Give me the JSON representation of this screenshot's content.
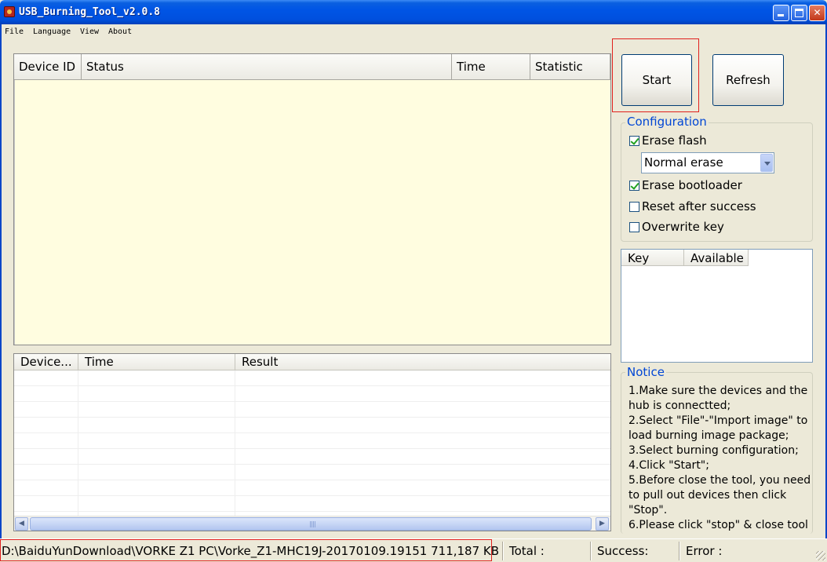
{
  "window": {
    "title": "USB_Burning_Tool_v2.0.8"
  },
  "menu": {
    "items": [
      "File",
      "Language",
      "View",
      "About"
    ]
  },
  "device_list": {
    "columns": [
      "Device ID",
      "Status",
      "Time",
      "Statistic"
    ]
  },
  "result_list": {
    "columns": [
      "Device...",
      "Time",
      "Result"
    ]
  },
  "buttons": {
    "start_label": "Start",
    "refresh_label": "Refresh"
  },
  "configuration": {
    "title": "Configuration",
    "erase_flash_label": "Erase flash",
    "erase_flash_checked": true,
    "erase_mode_selected": "Normal erase",
    "erase_bootloader_label": "Erase bootloader",
    "erase_bootloader_checked": true,
    "reset_after_success_label": "Reset after success",
    "reset_after_success_checked": false,
    "overwrite_key_label": "Overwrite key",
    "overwrite_key_checked": false
  },
  "key_list": {
    "columns": [
      "Key",
      "Available"
    ]
  },
  "notice": {
    "title": "Notice",
    "lines": [
      "1.Make sure the devices and the hub is connectted;",
      "2.Select \"File\"-\"Import image\" to load burning image package;",
      "3.Select burning configuration;",
      "4.Click \"Start\";",
      "5.Before close the tool, you need to pull out devices then click \"Stop\".",
      "6.Please click \"stop\" & close tool"
    ]
  },
  "status_bar": {
    "image_path": "D:\\BaiduYunDownload\\VORKE Z1 PC\\Vorke_Z1-MHC19J-20170109.19151 711,187 KB",
    "total_label": "Total :",
    "success_label": "Success:",
    "error_label": "Error :"
  },
  "colors": {
    "titlebar": "#0055e5",
    "device_list_bg": "#fffde0",
    "highlight": "#e0211d",
    "group_title": "#0046d5"
  }
}
